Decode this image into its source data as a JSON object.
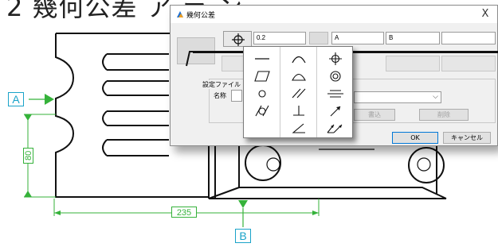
{
  "heading": {
    "text": "2 幾何公差 ア ラ ン"
  },
  "datums": {
    "a_label": "A",
    "b_label": "B"
  },
  "dimensions": {
    "height_label": "80",
    "width_label": "235"
  },
  "dialog": {
    "title": "幾何公差",
    "close_label": "X",
    "tolerance_value": "0.2",
    "datum1_value": "A",
    "datum2_value": "B",
    "datum3_value": "",
    "settings_label": "設定ファイル",
    "name_label": "名称",
    "write_button": "書込",
    "delete_button": "削除",
    "ok_button": "OK",
    "cancel_button": "キャンセル"
  },
  "palette": {
    "items": [
      "straightness-icon",
      "line-profile-icon",
      "position-icon",
      "flatness-icon",
      "surface-profile-icon",
      "concentricity-icon",
      "circularity-icon",
      "parallelism-icon",
      "symmetry-icon",
      "cylindricity-icon",
      "perpendicularity-icon",
      "circular-runout-icon",
      "empty",
      "angularity-icon",
      "total-runout-icon"
    ]
  },
  "colors": {
    "dimension": "#35b23a",
    "datum": "#1aa3c9",
    "accent": "#0078d7"
  }
}
